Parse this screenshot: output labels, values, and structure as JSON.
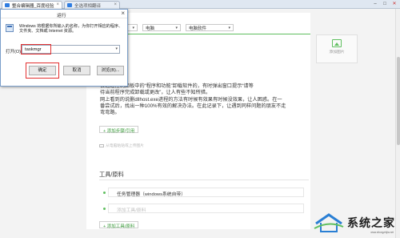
{
  "browser": {
    "tabs": [
      {
        "title": "整合编辑器_百度经验",
        "active": true
      },
      {
        "title": "全选项相翻译",
        "active": false
      }
    ],
    "window_controls": [
      "minimize",
      "maximize",
      "close"
    ]
  },
  "editor": {
    "category_selects": [
      "",
      "电脑",
      "电脑软件"
    ],
    "add_image_label": "添加图片",
    "step_text_lines": [
      "会通过控制面板中的“程序和功能”卸载软件的，有时弹出窗口提示“请等",
      "待当前程序完成卸载或更改”，让人有些不知所措。",
      "网上看到的说删dllhost.exe进程的方法有时候有效果有时候没效果，让人困惑。在一",
      "番尝试后，找出一种100%有效的解决办法。在此记录下，让遇到同样问题的朋友不走",
      "弯弯路。"
    ],
    "add_step_button": "+ 添加步骤/引用",
    "image_hint": "从电脑粘贴或上传图片",
    "tools_section_title": "工具/原料",
    "tools": [
      {
        "text": "任务管理器（windows系统自带）",
        "placeholder": false
      },
      {
        "text": "添加工具/原料",
        "placeholder": true
      }
    ],
    "add_tool_button": "+ 添加工具/原料"
  },
  "run_dialog": {
    "title": "运行",
    "description_lines": [
      "Windows 将根据你所输入的名称，为你打开相应的程序、",
      "文件夹、文档或 Internet 资源。"
    ],
    "open_label": "打开(O):",
    "open_value": "taskmgr",
    "buttons": [
      "确定",
      "取消",
      "浏览(B)..."
    ]
  },
  "watermark": {
    "text": "系统之家",
    "subtext": "www.xitongzhijia.net"
  },
  "colors": {
    "accent_green": "#5fbf5f",
    "highlight_red": "#e23030",
    "dialog_border": "#7a9ec9"
  }
}
